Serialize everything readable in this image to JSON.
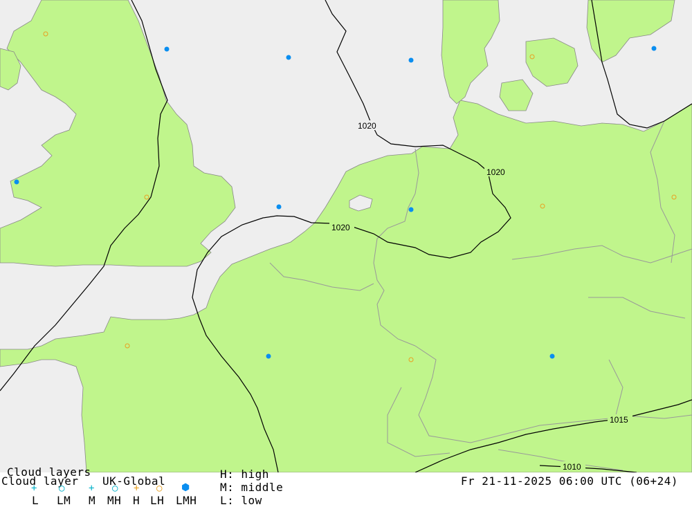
{
  "legend": {
    "title_top": "Cloud layers",
    "title": "Cloud layer",
    "model": "UK-Global",
    "datetime": "Fr 21-11-2025 06:00 UTC (06+24)",
    "layers_row": [
      "L",
      "LM",
      "M",
      "MH",
      "H",
      "LH",
      "LMH"
    ],
    "key_high": "H: high",
    "key_middle": "M: middle",
    "key_low": "L: low"
  },
  "isobars": {
    "label_a": "1020",
    "label_b": "1020",
    "label_c": "1020",
    "label_d": "1015",
    "label_e": "1010"
  },
  "colors": {
    "land": "#c0f58c",
    "sea": "#eeeeee",
    "border": "#999999",
    "isobar": "#000000",
    "lmh_symbol": "#0a8ef0",
    "orange_symbol": "#e8a020",
    "cyan_symbol": "#00b0c8"
  },
  "cloud_symbols": [
    {
      "type": "LMH"
    },
    {
      "type": "LMH"
    },
    {
      "type": "LMH"
    },
    {
      "type": "LMH"
    },
    {
      "type": "LMH"
    },
    {
      "type": "LMH"
    },
    {
      "type": "LMH"
    },
    {
      "type": "LMH"
    },
    {
      "type": "LMH"
    },
    {
      "type": "LMH"
    },
    {
      "type": "LH"
    },
    {
      "type": "LH"
    },
    {
      "type": "LH"
    },
    {
      "type": "LH"
    },
    {
      "type": "LH"
    },
    {
      "type": "LH"
    },
    {
      "type": "LH"
    }
  ]
}
